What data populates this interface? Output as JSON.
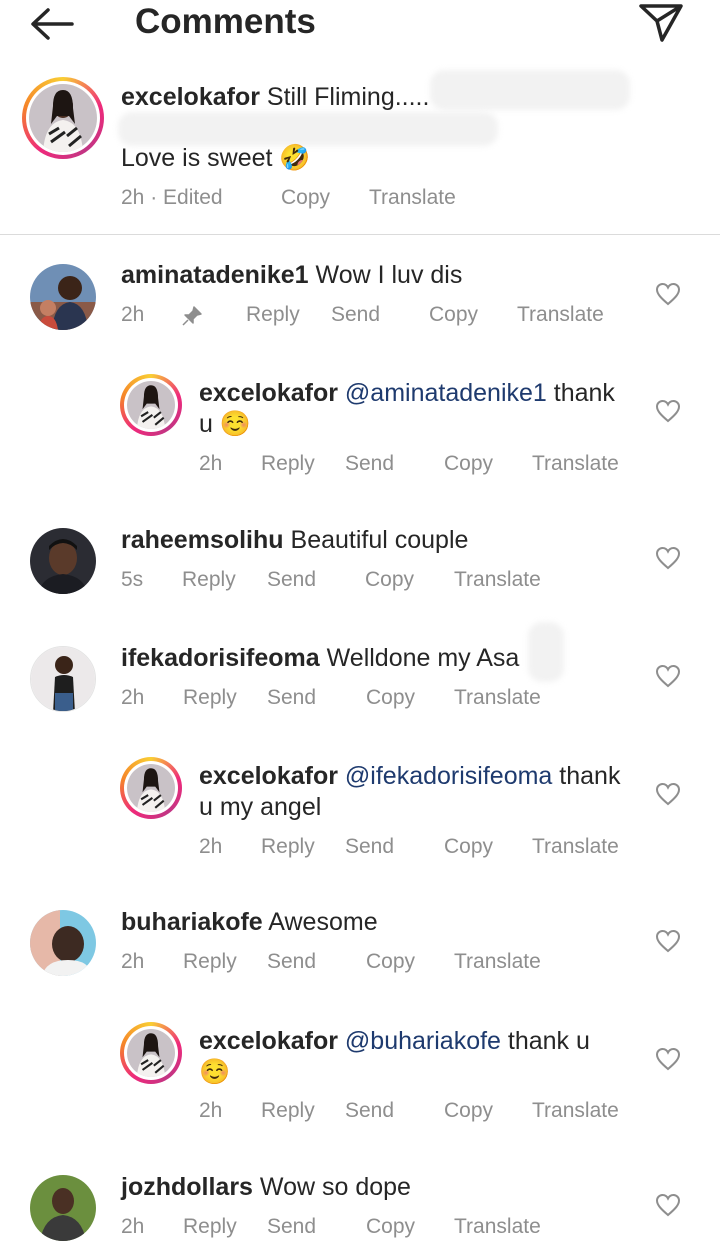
{
  "header": {
    "title": "Comments"
  },
  "caption": {
    "username": "excelokafor",
    "line1": "Still Fliming.....",
    "line2": "Love is sweet 🤣",
    "time": "2h · Edited",
    "copy": "Copy",
    "translate": "Translate"
  },
  "actions": {
    "reply": "Reply",
    "send": "Send",
    "copy": "Copy",
    "translate": "Translate"
  },
  "comments": [
    {
      "username": "aminatadenike1",
      "text": "Wow I luv dis",
      "time": "2h"
    },
    {
      "username": "excelokafor",
      "mention": "@aminatadenike1",
      "text_after": " thank",
      "line2": "u ☺️",
      "time": "2h"
    },
    {
      "username": "raheemsolihu",
      "text": "Beautiful couple",
      "time": "5s"
    },
    {
      "username": "ifekadorisifeoma",
      "text": "Welldone my Asa",
      "time": "2h"
    },
    {
      "username": "excelokafor",
      "mention": "@ifekadorisifeoma",
      "text_after": " thank",
      "line2": "u my angel",
      "time": "2h"
    },
    {
      "username": "buhariakofe",
      "text": "Awesome",
      "time": "2h"
    },
    {
      "username": "excelokafor",
      "mention": "@buhariakofe",
      "text_after": " thank u",
      "line2": "☺️",
      "time": "2h"
    },
    {
      "username": "jozhdollars",
      "text": "Wow so dope",
      "time": "2h"
    }
  ]
}
